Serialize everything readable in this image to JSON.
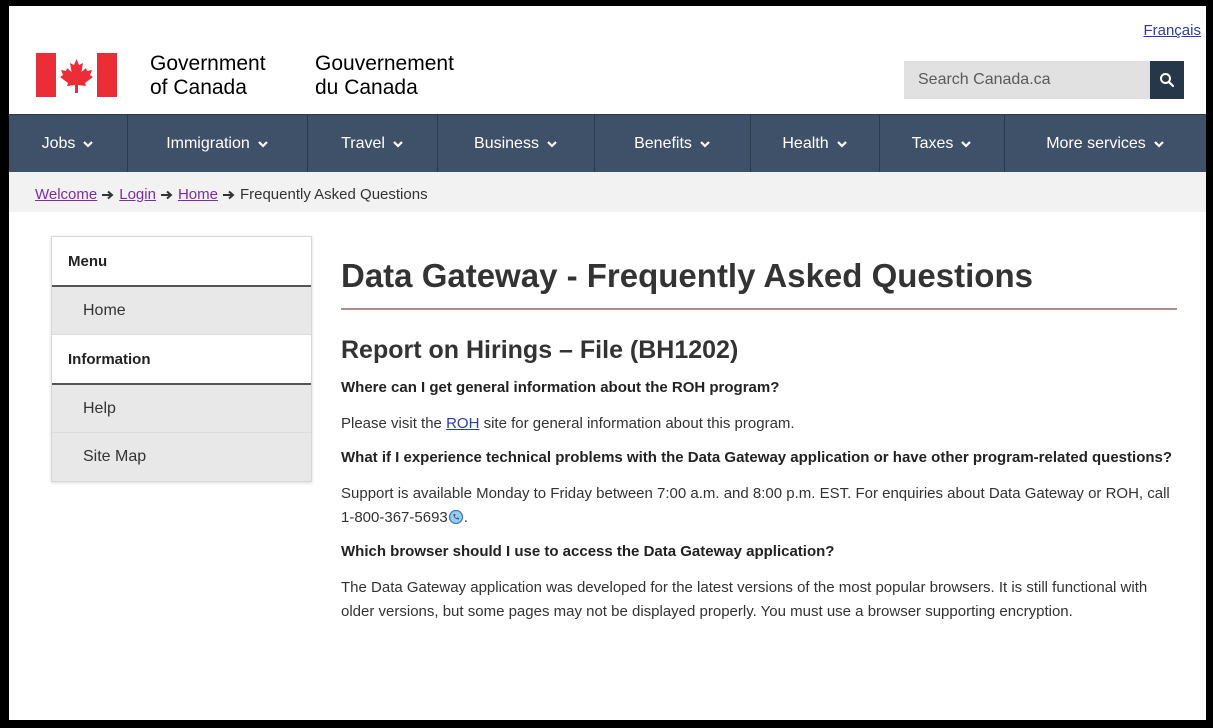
{
  "header": {
    "language_link": "Français",
    "signature_en_line1": "Government",
    "signature_en_line2": "of Canada",
    "signature_fr_line1": "Gouvernement",
    "signature_fr_line2": "du Canada",
    "search_placeholder": "Search Canada.ca"
  },
  "nav": {
    "items": [
      {
        "label": "Jobs"
      },
      {
        "label": "Immigration"
      },
      {
        "label": "Travel"
      },
      {
        "label": "Business"
      },
      {
        "label": "Benefits"
      },
      {
        "label": "Health"
      },
      {
        "label": "Taxes"
      },
      {
        "label": "More services"
      }
    ]
  },
  "breadcrumb": {
    "items": [
      "Welcome",
      "Login",
      "Home"
    ],
    "current": "Frequently Asked Questions"
  },
  "sidebar": {
    "menu_heading": "Menu",
    "home": "Home",
    "info_heading": "Information",
    "help": "Help",
    "sitemap": "Site Map"
  },
  "main": {
    "title": "Data Gateway - Frequently Asked Questions",
    "section_title": "Report on Hirings – File (BH1202)",
    "q1": "Where can I get general information about the ROH program?",
    "a1_before": "Please visit the ",
    "a1_link": "ROH",
    "a1_after": " site for general information about this program.",
    "q2": "What if I experience technical problems with the Data Gateway application or have other program-related questions?",
    "a2_before": "Support is available Monday to Friday between 7:00 a.m. and 8:00 p.m. EST. For enquiries about Data Gateway or ROH, call 1-800-367-5693",
    "a2_after": ".",
    "q3": "Which browser should I use to access the Data Gateway application?",
    "a3": "The Data Gateway application was developed for the latest versions of the most popular browsers. It is still functional with older versions, but some pages may not be displayed properly. You must use a browser supporting encryption."
  },
  "colors": {
    "nav_bg": "#3e5169",
    "flag_red": "#eb2d37",
    "link": "#2b3cab",
    "visited_link": "#7a2ea8",
    "title_rule": "#b58a8a"
  },
  "icons": [
    "canada-flag",
    "search-icon",
    "chevron-down-icon",
    "arrow-right-icon",
    "phone-icon"
  ]
}
